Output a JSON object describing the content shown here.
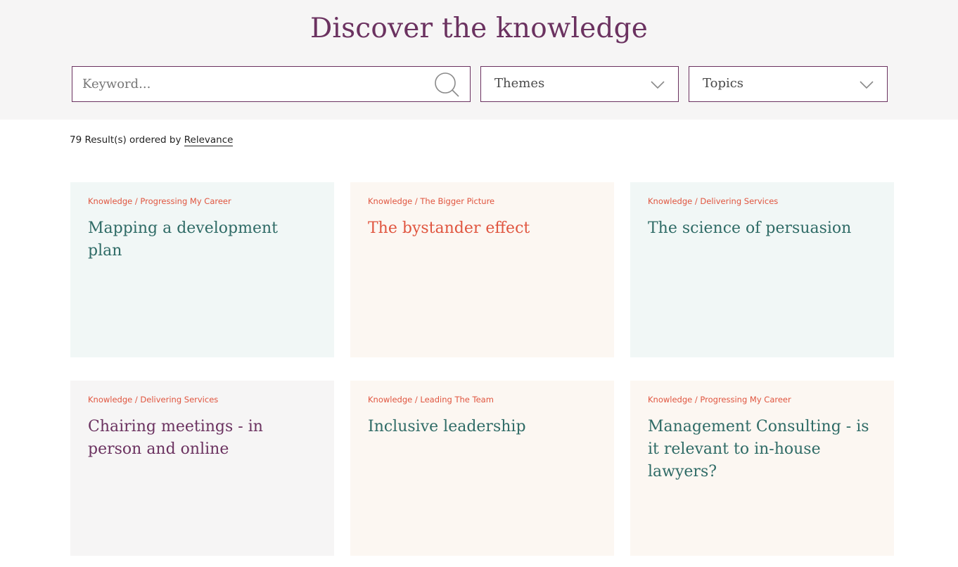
{
  "header": {
    "title": "Discover the knowledge"
  },
  "filters": {
    "search": {
      "placeholder": "Keyword...",
      "value": ""
    },
    "themes": {
      "label": "Themes"
    },
    "topics": {
      "label": "Topics"
    }
  },
  "results": {
    "summary": "79 Result(s) ordered by ",
    "sort_label": "Relevance"
  },
  "colors": {
    "brand_purple": "#6b3260",
    "accent_coral": "#e0553f",
    "teal_text": "#2f6b66",
    "card_teal_bg": "#f1f7f6",
    "card_cream_bg": "#fcf7f2",
    "card_grey_bg": "#f6f5f5"
  },
  "cards": [
    {
      "breadcrumb": "Knowledge / Progressing My Career",
      "title": "Mapping a development plan",
      "bg": "#f1f7f6",
      "title_color": "#2f6b66"
    },
    {
      "breadcrumb": "Knowledge / The Bigger Picture",
      "title": "The bystander effect",
      "bg": "#fcf7f2",
      "title_color": "#e0553f"
    },
    {
      "breadcrumb": "Knowledge / Delivering Services",
      "title": "The science of persuasion",
      "bg": "#f1f7f6",
      "title_color": "#2f6b66"
    },
    {
      "breadcrumb": "Knowledge / Delivering Services",
      "title": "Chairing meetings - in person and online",
      "bg": "#f6f5f5",
      "title_color": "#6b3260"
    },
    {
      "breadcrumb": "Knowledge / Leading The Team",
      "title": "Inclusive leadership",
      "bg": "#fcf7f2",
      "title_color": "#2f6b66"
    },
    {
      "breadcrumb": "Knowledge / Progressing My Career",
      "title": "Management Consulting - is it relevant to in-house lawyers?",
      "bg": "#fcf7f2",
      "title_color": "#2f6b66"
    }
  ]
}
